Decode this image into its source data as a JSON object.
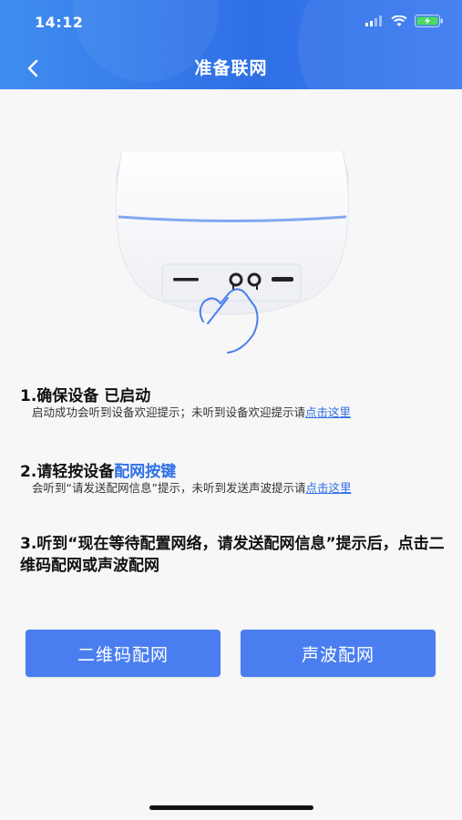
{
  "status_bar": {
    "time": "14:12"
  },
  "nav": {
    "title": "准备联网"
  },
  "steps": [
    {
      "title": "1.确保设备 已启动",
      "desc_prefix": "启动成功会听到设备欢迎提示；未听到设备欢迎提示请",
      "link": "点击这里"
    },
    {
      "title_prefix": "2.请轻按设备",
      "title_highlight": "配网按键",
      "desc_prefix": "会听到“请发送配网信息”提示，未听到发送声波提示请",
      "link": "点击这里"
    },
    {
      "title": "3.听到“现在等待配置网络，请发送配网信息”提示后，点击二维码配网或声波配网"
    }
  ],
  "buttons": {
    "qr": "二维码配网",
    "sound": "声波配网"
  },
  "colors": {
    "header": "#2f6fe6",
    "accent": "#2f6fe6",
    "button": "#4a7ef0"
  }
}
